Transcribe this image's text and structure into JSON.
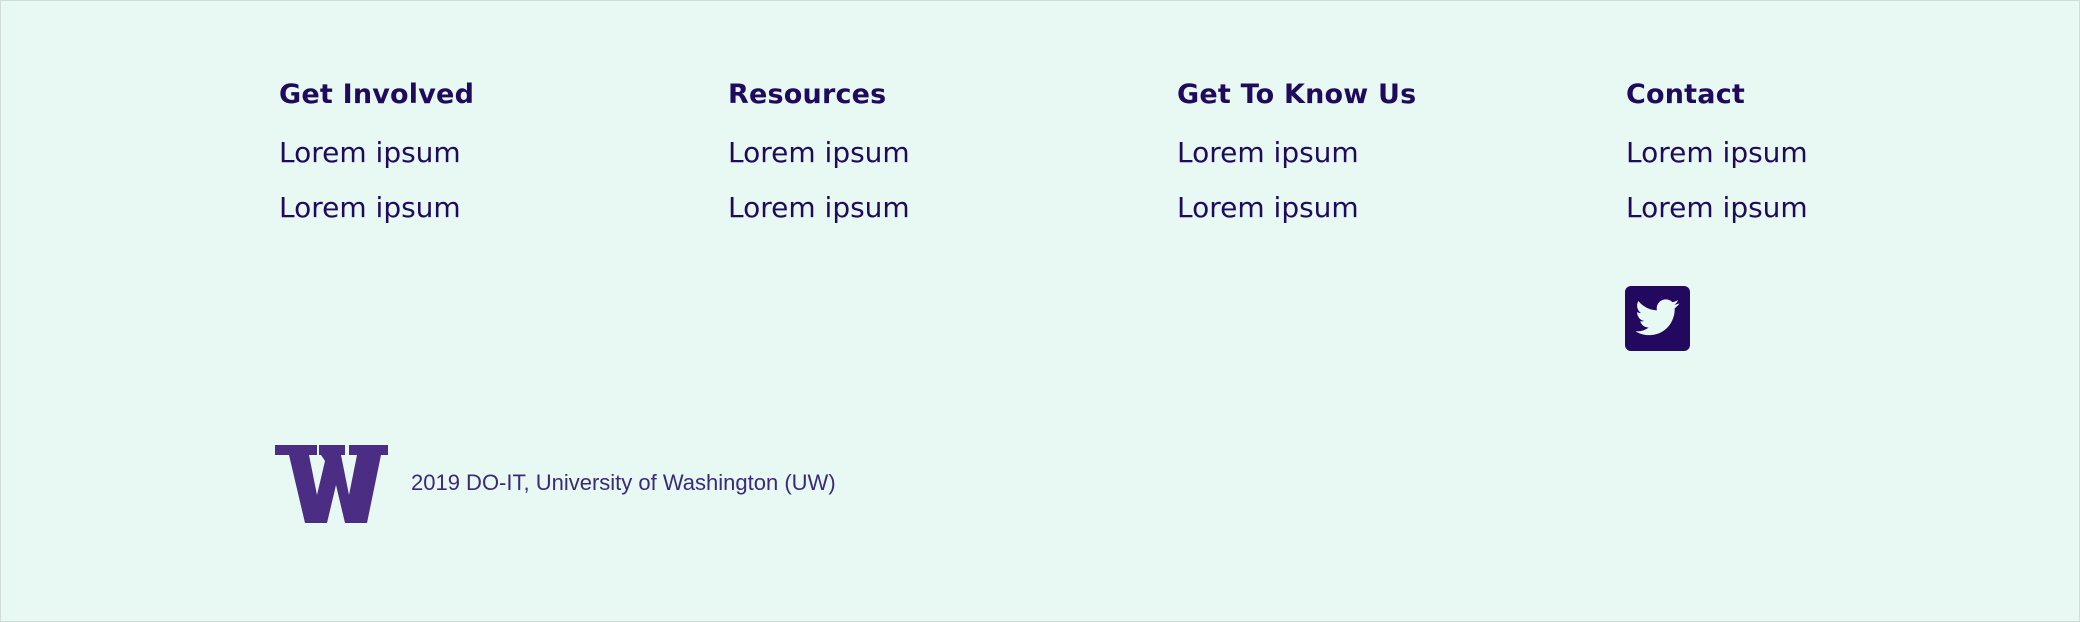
{
  "footer": {
    "columns": [
      {
        "heading": "Get Involved",
        "links": [
          "Lorem ipsum",
          "Lorem ipsum"
        ]
      },
      {
        "heading": "Resources",
        "links": [
          "Lorem ipsum",
          "Lorem ipsum"
        ]
      },
      {
        "heading": "Get To Know Us",
        "links": [
          "Lorem ipsum",
          "Lorem ipsum"
        ]
      },
      {
        "heading": "Contact",
        "links": [
          "Lorem ipsum",
          "Lorem ipsum"
        ]
      }
    ],
    "social": {
      "icon": "twitter-icon"
    },
    "logo": {
      "icon": "uw-w-logo"
    },
    "copyright": "2019 DO-IT, University of Washington (UW)"
  },
  "colors": {
    "background": "#e8f8f3",
    "text": "#1f0a5c",
    "brand_purple": "#4b2e83",
    "twitter_bg": "#22095f"
  }
}
